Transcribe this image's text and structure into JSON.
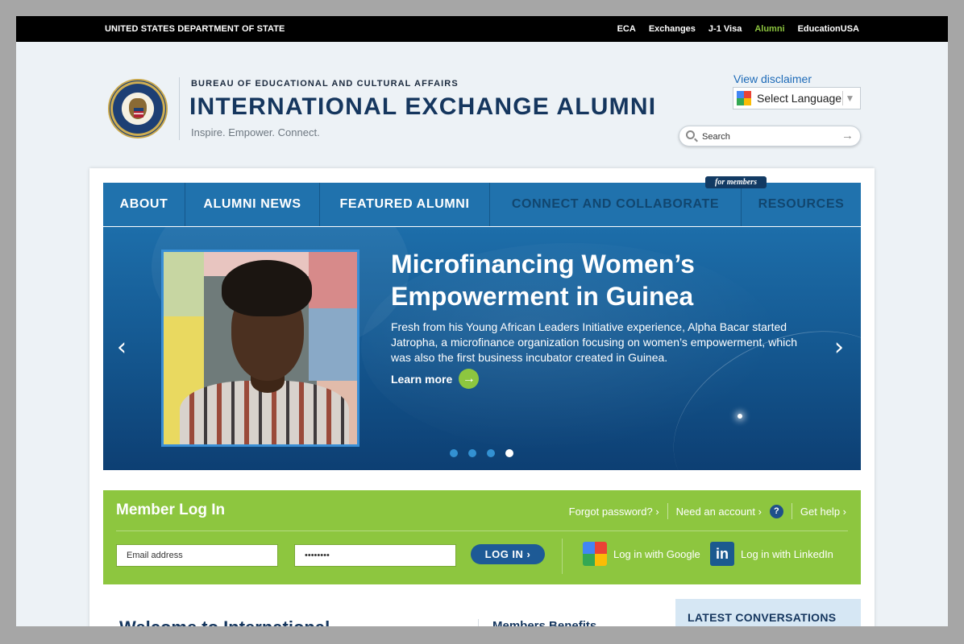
{
  "topbar": {
    "department": "UNITED STATES DEPARTMENT OF STATE",
    "links": [
      {
        "label": "ECA",
        "active": false
      },
      {
        "label": "Exchanges",
        "active": false
      },
      {
        "label": "J-1 Visa",
        "active": false
      },
      {
        "label": "Alumni",
        "active": true
      },
      {
        "label": "EducationUSA",
        "active": false
      }
    ]
  },
  "header": {
    "bureau": "BUREAU OF EDUCATIONAL AND CULTURAL AFFAIRS",
    "title": "INTERNATIONAL EXCHANGE ALUMNI",
    "tagline": "Inspire. Empower. Connect.",
    "disclaimer": "View disclaimer",
    "language_select": "Select Language",
    "search_placeholder": "Search"
  },
  "nav": {
    "items": [
      {
        "label": "ABOUT"
      },
      {
        "label": "ALUMNI NEWS"
      },
      {
        "label": "FEATURED ALUMNI"
      },
      {
        "label": "CONNECT AND COLLABORATE"
      },
      {
        "label": "RESOURCES"
      }
    ],
    "members_tag": "for members"
  },
  "hero": {
    "title": "Microfinancing Women’s Empowerment in Guinea",
    "text": "Fresh from his Young African Leaders Initiative experience, Alpha Bacar started Jatropha, a microfinance organization focusing on women’s empowerment, which was also the first business incubator created in Guinea.",
    "learn_more": "Learn more",
    "slide_count": 4,
    "active_slide": 4
  },
  "login": {
    "title": "Member Log In",
    "forgot": "Forgot password? ›",
    "need_account": "Need an account ›",
    "help_icon": "?",
    "get_help": "Get help ›",
    "email_placeholder": "Email address",
    "password_value": "••••••••",
    "login_button": "LOG IN ›",
    "google": "Log in with Google",
    "linkedin": "Log in with LinkedIn",
    "linkedin_glyph": "in"
  },
  "bottom": {
    "welcome": "Welcome to International",
    "benefits": "Members Benefits",
    "latest": "LATEST CONVERSATIONS"
  },
  "colors": {
    "nav_blue": "#2072ad",
    "brand_navy": "#15365e",
    "login_green": "#8dc63f",
    "alumni_active": "#8dc63f"
  }
}
